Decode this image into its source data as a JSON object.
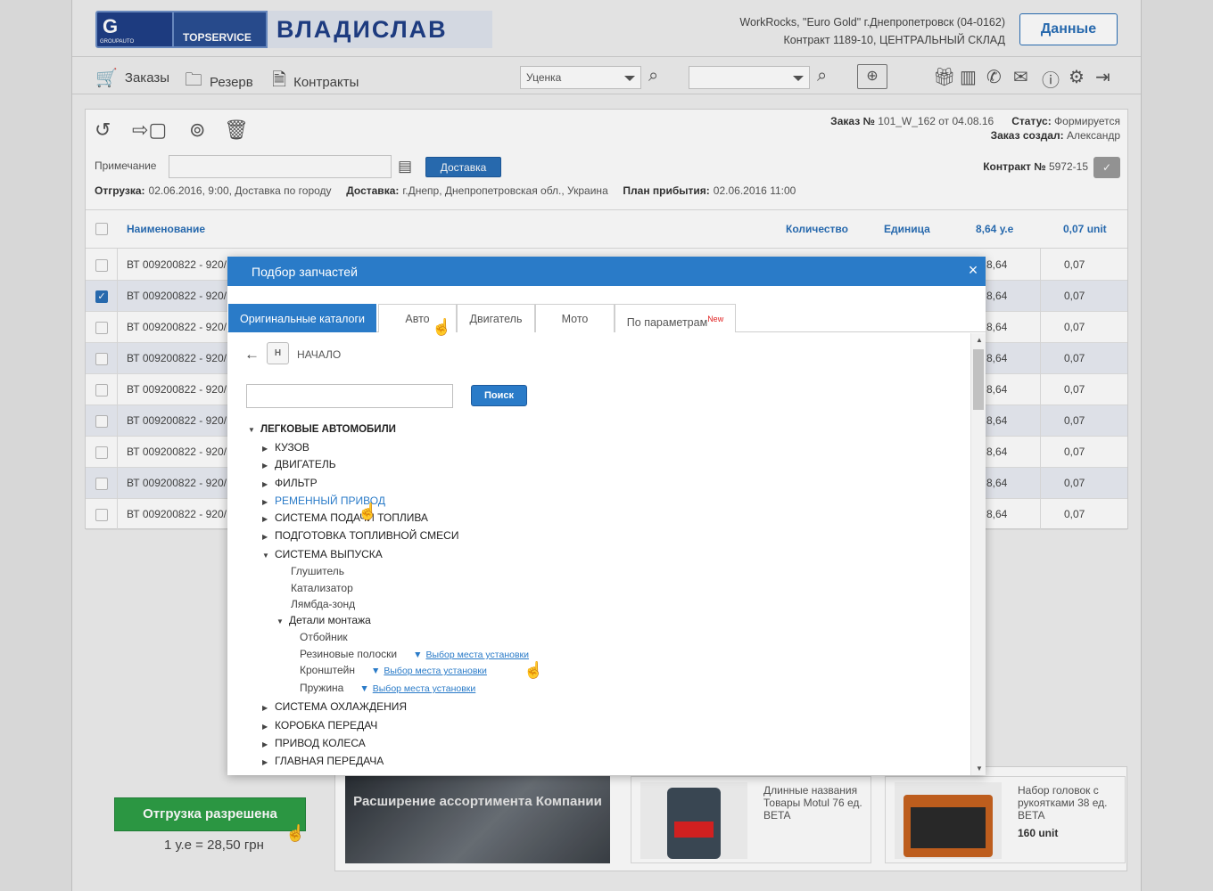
{
  "header": {
    "logo_g": "G",
    "logo_g_small": "GROUPAUTO",
    "logo_ts": "TOPSERVICE",
    "logo_name": "ВЛАДИСЛАВ",
    "info_line1": "WorkRocks, \"Euro Gold\" г.Днепропетровск (04-0162)",
    "info_line2": "Контракт 1189-10, ЦЕНТРАЛЬНЫЙ СКЛАД",
    "data_button": "Данные"
  },
  "nav": {
    "orders": "Заказы",
    "reserve": "Резерв",
    "contracts": "Контракты",
    "select1": "Уценка",
    "select2": ""
  },
  "order": {
    "info_line1_label": "Заказ №",
    "info_line1_value": "101_W_162 от 04.08.16",
    "status_label": "Статус:",
    "status_value": "Формируется",
    "created_label": "Заказ создал:",
    "created_value": "Александр",
    "note_label": "Примечание",
    "delivery_button": "Доставка",
    "contract_label": "Контракт №",
    "contract_value": "5972-15",
    "ship_label": "Отгрузка:",
    "ship_value": "02.06.2016, 9:00, Доставка по городу",
    "delivery_label": "Доставка:",
    "delivery_value": "г.Днепр, Днепропетровская обл., Украина",
    "arrival_label": "План прибытия:",
    "arrival_value": "02.06.2016 11:00"
  },
  "table": {
    "col_name": "Наименование",
    "col_qty": "Количество",
    "col_unit": "Единица",
    "col_price": "8,64 у.е",
    "col_units": "0,07 unit",
    "rows": [
      {
        "name": "ВТ 009200822 - 920/",
        "price": "8,64",
        "units": "0,07",
        "checked": false
      },
      {
        "name": "ВТ 009200822 - 920/",
        "price": "8,64",
        "units": "0,07",
        "checked": true
      },
      {
        "name": "ВТ 009200822 - 920/",
        "price": "8,64",
        "units": "0,07",
        "checked": false
      },
      {
        "name": "ВТ 009200822 - 920/",
        "price": "8,64",
        "units": "0,07",
        "checked": false
      },
      {
        "name": "ВТ 009200822 - 920/",
        "price": "8,64",
        "units": "0,07",
        "checked": false
      },
      {
        "name": "ВТ 009200822 - 920/",
        "price": "8,64",
        "units": "0,07",
        "checked": false
      },
      {
        "name": "ВТ 009200822 - 920/",
        "price": "8,64",
        "units": "0,07",
        "checked": false
      },
      {
        "name": "ВТ 009200822 - 920/",
        "price": "8,64",
        "units": "0,07",
        "checked": false
      },
      {
        "name": "ВТ 009200822 - 920/",
        "price": "8,64",
        "units": "0,07",
        "checked": false
      }
    ]
  },
  "footer": {
    "ship_button": "Отгрузка разрешена",
    "rate": "1 у.е = 28,50 грн",
    "banner": "Расширение ассортимента Компании",
    "product1": "Длинные названия Товары Motul 76 ед. BETA",
    "product2": "Набор головок с рукоятками 38 ед. BETA",
    "product2_price": "160 unit"
  },
  "modal": {
    "title": "Подбор запчастей",
    "close": "×",
    "tabs": {
      "original": "Оригинальные каталоги",
      "auto": "Авто",
      "engine": "Двигатель",
      "moto": "Мото",
      "params": "По параметрам",
      "params_badge": "New"
    },
    "logo": "H",
    "breadcrumb": "НАЧАЛО",
    "search_button": "Поиск",
    "search_value": "",
    "tree": {
      "root": "ЛЕГКОВЫЕ АВТОМОБИЛИ",
      "body": "КУЗОВ",
      "engine": "ДВИГАТЕЛЬ",
      "filter": "ФИЛЬТР",
      "belt": "РЕМЕННЫЙ ПРИВОД",
      "fuel": "СИСТЕМА ПОДАЧИ ТОПЛИВА",
      "mixture": "ПОДГОТОВКА ТОПЛИВНОЙ СМЕСИ",
      "exhaust": "СИСТЕМА ВЫПУСКА",
      "muffler": "Глушитель",
      "catalyst": "Катализатор",
      "lambda": "Лямбда-зонд",
      "mount": "Детали монтажа",
      "bumper": "Отбойник",
      "rubber": "Резиновые полоски",
      "bracket": "Кронштейн",
      "spring": "Пружина",
      "filter_link": "Выбор места установки",
      "cooling": "СИСТЕМА ОХЛАЖДЕНИЯ",
      "gearbox": "КОРОБКА ПЕРЕДАЧ",
      "wheeldrive": "ПРИВОД КОЛЕСА",
      "maingear": "ГЛАВНАЯ ПЕРЕДАЧА"
    }
  }
}
